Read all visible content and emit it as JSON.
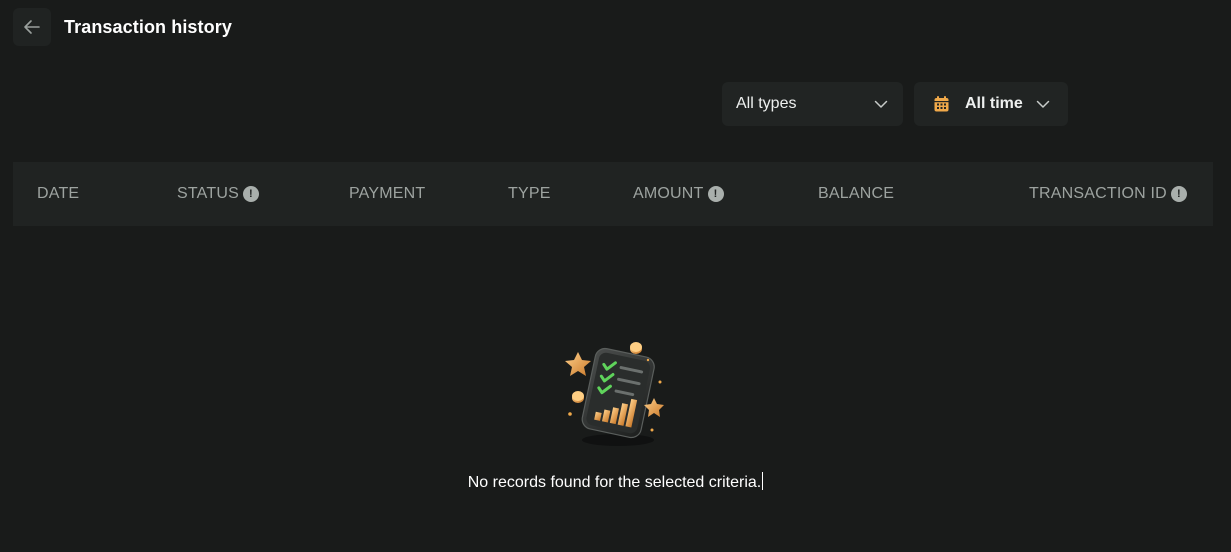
{
  "header": {
    "title": "Transaction history",
    "back_icon": "arrow-left-icon"
  },
  "filters": {
    "type": {
      "label": "All types",
      "icon": "chevron-down-icon"
    },
    "time": {
      "label": "All time",
      "icon": "calendar-icon"
    }
  },
  "table": {
    "columns": [
      {
        "label": "DATE",
        "info": false
      },
      {
        "label": "STATUS",
        "info": true
      },
      {
        "label": "PAYMENT",
        "info": false
      },
      {
        "label": "TYPE",
        "info": false
      },
      {
        "label": "AMOUNT",
        "info": true
      },
      {
        "label": "BALANCE",
        "info": false
      },
      {
        "label": "TRANSACTION ID",
        "info": true
      }
    ],
    "info_glyph": "!"
  },
  "empty_state": {
    "message": "No records found for the selected criteria.",
    "illustration": "clipboard-chart-illustration"
  },
  "colors": {
    "background": "#191b1a",
    "surface": "#202322",
    "accent": "#f0a94a",
    "check": "#5fd35b"
  }
}
